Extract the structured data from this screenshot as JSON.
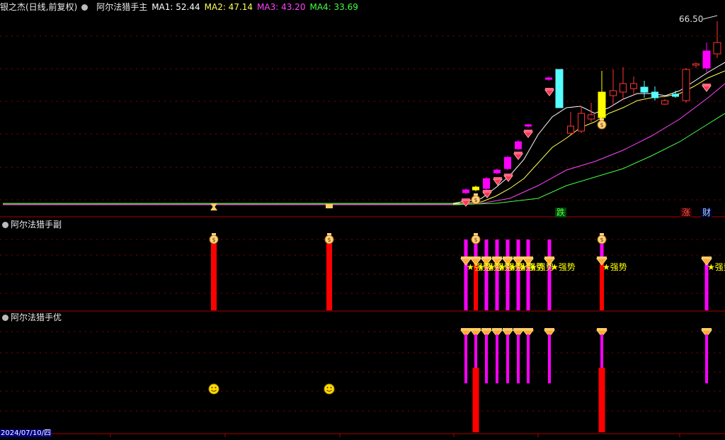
{
  "main_header": {
    "stock": "银之杰(日线,前复权)",
    "indicator": "阿尔法猎手主",
    "ma": [
      {
        "label": "MA1: 52.44",
        "color": "#ffffff"
      },
      {
        "label": "MA2: 47.14",
        "color": "#ffff55"
      },
      {
        "label": "MA3: 43.20",
        "color": "#ff44ff"
      },
      {
        "label": "MA4: 33.69",
        "color": "#44ff44"
      }
    ]
  },
  "price_high_label": "66.50",
  "panels": {
    "sub1_title": "阿尔法猎手副",
    "sub2_title": "阿尔法猎手优"
  },
  "markers": {
    "die": "跌",
    "zhang": "涨",
    "cai": "财"
  },
  "strong_label": "★强势",
  "date_label": "2024/07/10/四",
  "colors": {
    "up": "#ff3333",
    "down": "#55ffff",
    "magenta": "#ff00ff",
    "red_bar": "#ff0000",
    "yellow": "#ffff00",
    "grid": "#8b0000"
  }
}
